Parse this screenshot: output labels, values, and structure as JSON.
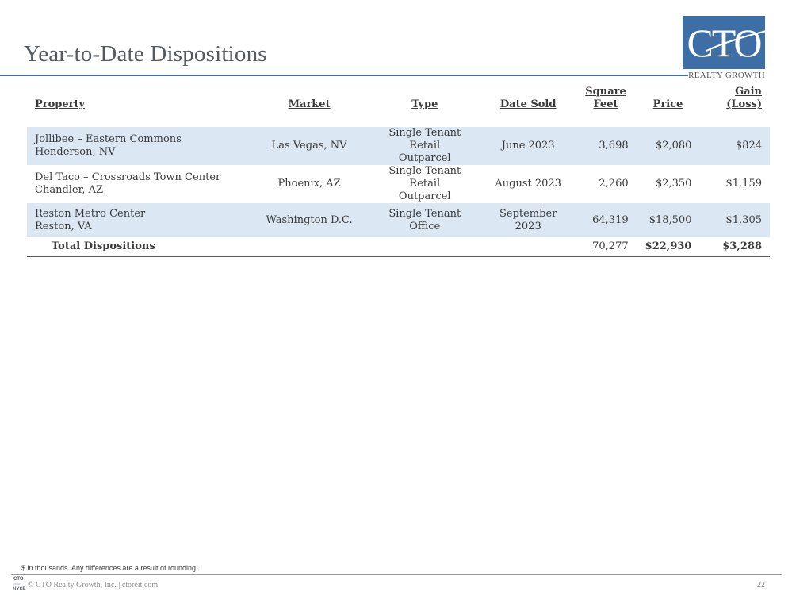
{
  "slide": {
    "title": "Year-to-Date Dispositions",
    "page_number": "22"
  },
  "logo": {
    "main_text": "CTO",
    "sub_text": "REALTY GROWTH",
    "color": "#3d6ea6"
  },
  "table": {
    "headers": {
      "property": "Property",
      "market": "Market",
      "type": "Type",
      "date_sold": "Date Sold",
      "square_feet_line1": "Square",
      "square_feet_line2": "Feet",
      "price": "Price",
      "gain_loss": "Gain (Loss)"
    },
    "rows": [
      {
        "property_line1": "Jollibee – Eastern Commons",
        "property_line2": "Henderson, NV",
        "market": "Las Vegas, NV",
        "type_line1": "Single Tenant Retail",
        "type_line2": "Outparcel",
        "date_sold": "June 2023",
        "square_feet": "3,698",
        "price": "$2,080",
        "gain_loss": "$824"
      },
      {
        "property_line1": "Del Taco – Crossroads Town Center",
        "property_line2": "Chandler, AZ",
        "market": "Phoenix, AZ",
        "type_line1": "Single Tenant Retail",
        "type_line2": "Outparcel",
        "date_sold": "August 2023",
        "square_feet": "2,260",
        "price": "$2,350",
        "gain_loss": "$1,159"
      },
      {
        "property_line1": "Reston Metro Center",
        "property_line2": "Reston, VA",
        "market": "Washington D.C.",
        "type_line1": "Single Tenant Office",
        "type_line2": "",
        "date_sold": "September 2023",
        "square_feet": "64,319",
        "price": "$18,500",
        "gain_loss": "$1,305"
      }
    ],
    "total": {
      "label": "Total Dispositions",
      "square_feet": "70,277",
      "price": "$22,930",
      "gain_loss": "$3,288"
    },
    "row_shading_color": "#dbe7f3"
  },
  "footnote": "$ in thousands. Any differences are a result of rounding.",
  "footer": {
    "logo_line1": "CTO",
    "logo_line2": "LISTED",
    "logo_line3": "NYSE",
    "text": "© CTO Realty Growth, Inc. | ctoreit.com"
  }
}
